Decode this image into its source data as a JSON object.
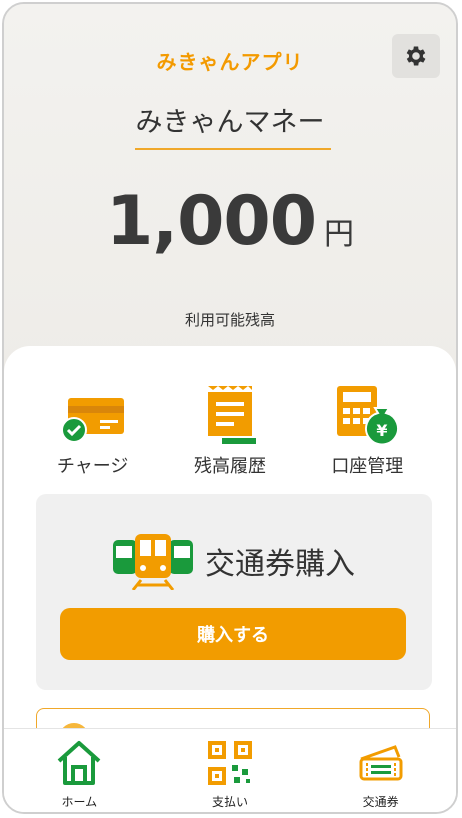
{
  "header": {
    "app_title": "みきゃんアプリ",
    "settings_icon": "gear-icon"
  },
  "wallet": {
    "title": "みきゃんマネー",
    "balance": "1,000",
    "unit": "円",
    "caption": "利用可能残高"
  },
  "menu": [
    {
      "label": "チャージ",
      "icon": "card-check-icon"
    },
    {
      "label": "残高履歴",
      "icon": "receipt-icon"
    },
    {
      "label": "口座管理",
      "icon": "calculator-yen-icon"
    }
  ],
  "ticket": {
    "title": "交通券購入",
    "icon": "train-icon",
    "button": "購入する"
  },
  "tabs": [
    {
      "label": "ホーム",
      "icon": "home-icon"
    },
    {
      "label": "支払い",
      "icon": "qr-code-icon"
    },
    {
      "label": "交通券",
      "icon": "ticket-icon"
    }
  ],
  "colors": {
    "accent": "#f29c00",
    "green": "#1a9a3c",
    "text": "#333333"
  }
}
